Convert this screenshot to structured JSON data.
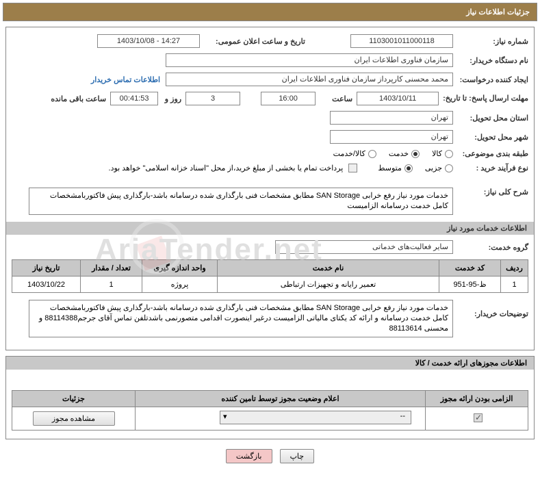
{
  "header": {
    "title": "جزئیات اطلاعات نیاز"
  },
  "fields": {
    "need_no_label": "شماره نیاز:",
    "need_no": "1103001011000118",
    "pub_date_label": "تاریخ و ساعت اعلان عمومی:",
    "pub_date": "1403/10/08 - 14:27",
    "buyer_org_label": "نام دستگاه خریدار:",
    "buyer_org": "سازمان فناوری اطلاعات ایران",
    "requester_label": "ایجاد کننده درخواست:",
    "requester": "محمد محسنی کارپرداز سازمان فناوری اطلاعات ایران",
    "contact_link": "اطلاعات تماس خریدار",
    "deadline_label": "مهلت ارسال پاسخ: تا تاریخ:",
    "deadline_date": "1403/10/11",
    "time_label": "ساعت",
    "deadline_time": "16:00",
    "days_remain": "3",
    "days_label": "روز و",
    "hms_remain": "00:41:53",
    "hms_label": "ساعت باقی مانده",
    "province_label": "استان محل تحویل:",
    "province": "تهران",
    "city_label": "شهر محل تحویل:",
    "city": "تهران",
    "category_label": "طبقه بندی موضوعی:",
    "cat_goods": "کالا",
    "cat_service": "خدمت",
    "cat_both": "کالا/خدمت",
    "purchase_type_label": "نوع فرآیند خرید :",
    "pt_partial": "جزیی",
    "pt_medium": "متوسط",
    "payment_note": "پرداخت تمام یا بخشی از مبلغ خرید،از محل \"اسناد خزانه اسلامی\" خواهد بود."
  },
  "desc": {
    "label": "شرح کلی نیاز:",
    "text": "خدمات مورد نیاز رفع خرابی SAN Storage مطابق مشخصات فنی بارگذاری شده درسامانه باشد-بارگذاری پیش فاکتوربامشخصات کامل خدمت درسامانه الزامیست"
  },
  "section_services": "اطلاعات خدمات مورد نیاز",
  "group": {
    "label": "گروه خدمت:",
    "value": "سایر فعالیت‌های خدماتی"
  },
  "table": {
    "h_row": "ردیف",
    "h_code": "کد خدمت",
    "h_name": "نام خدمت",
    "h_unit": "واحد اندازه گیری",
    "h_qty": "تعداد / مقدار",
    "h_date": "تاریخ نیاز",
    "r1": {
      "row": "1",
      "code": "ظ-95-951",
      "name": "تعمیر رایانه و تجهیزات ارتباطی",
      "unit": "پروژه",
      "qty": "1",
      "date": "1403/10/22"
    }
  },
  "buyer_notes": {
    "label": "توضیحات خریدار:",
    "text": "خدمات مورد نیاز رفع خرابی SAN Storage مطابق مشخصات فنی بارگذاری شده درسامانه باشد-بارگذاری پیش فاکتوربامشخصات کامل خدمت درسامانه و ارائه کد یکتای مالیاتی الزامیست درغیر اینصورت اقدامی متصورنمی باشدتلفن تماس آقای جرجم88114388 و محسنی 88113614"
  },
  "permits_title": "اطلاعات مجوزهای ارائه خدمت / کالا",
  "permits_table": {
    "h_mandatory": "الزامی بودن ارائه مجوز",
    "h_status": "اعلام وضعیت مجوز توسط تامین کننده",
    "h_details": "جزئیات",
    "dropdown_val": "--",
    "view_btn": "مشاهده مجوز"
  },
  "buttons": {
    "print": "چاپ",
    "back": "بازگشت"
  }
}
